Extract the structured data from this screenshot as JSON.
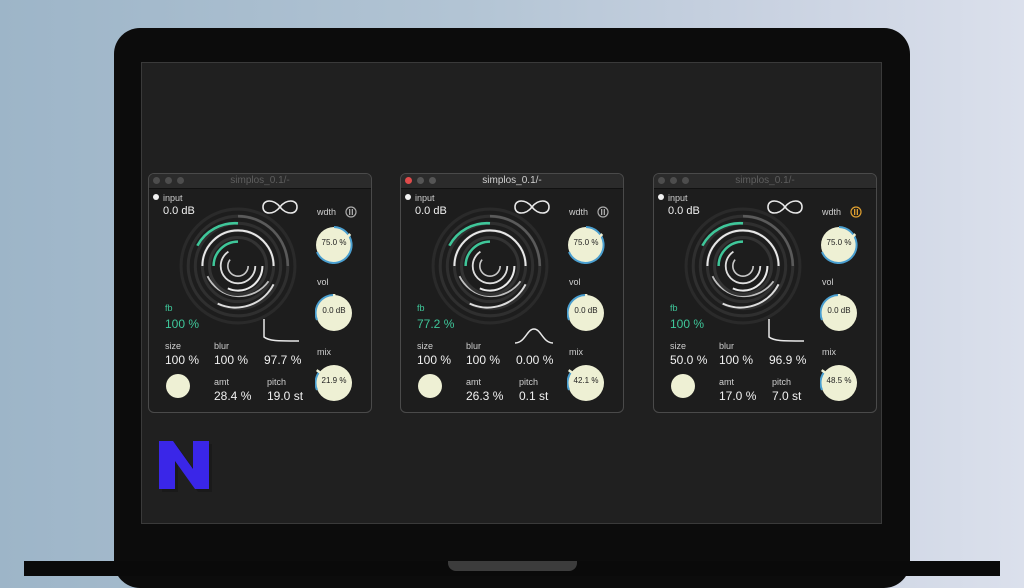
{
  "plugins": [
    {
      "title": "simplos_0.1/-",
      "active": false,
      "input_label": "input",
      "input_value": "0.0 dB",
      "fb_label": "fb",
      "fb_value": "100 %",
      "size_label": "size",
      "size_value": "100 %",
      "blur_label": "blur",
      "blur_value": "100 %",
      "shape_value": "97.7 %",
      "amt_label": "amt",
      "amt_value": "28.4 %",
      "pitch_label": "pitch",
      "pitch_value": "19.0 st",
      "wdth_label": "wdth",
      "wdth_value": "75.0 %",
      "vol_label": "vol",
      "vol_value": "0.0 dB",
      "mix_label": "mix",
      "mix_value": "21.9 %",
      "curve_icon": "decay-curve-icon"
    },
    {
      "title": "simplos_0.1/-",
      "active": true,
      "input_label": "input",
      "input_value": "0.0 dB",
      "fb_label": "fb",
      "fb_value": "77.2 %",
      "size_label": "size",
      "size_value": "100 %",
      "blur_label": "blur",
      "blur_value": "100 %",
      "shape_value": "0.00 %",
      "amt_label": "amt",
      "amt_value": "26.3 %",
      "pitch_label": "pitch",
      "pitch_value": "0.1 st",
      "wdth_label": "wdth",
      "wdth_value": "75.0 %",
      "vol_label": "vol",
      "vol_value": "0.0 dB",
      "mix_label": "mix",
      "mix_value": "42.1 %",
      "curve_icon": "bell-curve-icon"
    },
    {
      "title": "simplos_0.1/-",
      "active": false,
      "input_label": "input",
      "input_value": "0.0 dB",
      "fb_label": "fb",
      "fb_value": "100 %",
      "size_label": "size",
      "size_value": "50.0 %",
      "blur_label": "blur",
      "blur_value": "100 %",
      "shape_value": "96.9 %",
      "amt_label": "amt",
      "amt_value": "17.0 %",
      "pitch_label": "pitch",
      "pitch_value": "7.0 st",
      "wdth_label": "wdth",
      "wdth_value": "75.0 %",
      "vol_label": "vol",
      "vol_value": "0.0 dB",
      "mix_label": "mix",
      "mix_value": "48.5 %",
      "curve_icon": "decay-curve-icon"
    }
  ],
  "colors": {
    "accent_green": "#3fc79a",
    "knob_face": "#eef0d4",
    "knob_arc": "#4a9fd0",
    "mono_icon_active": "#e0a030"
  },
  "logo": {
    "letter": "N",
    "color": "#3a26e8"
  }
}
